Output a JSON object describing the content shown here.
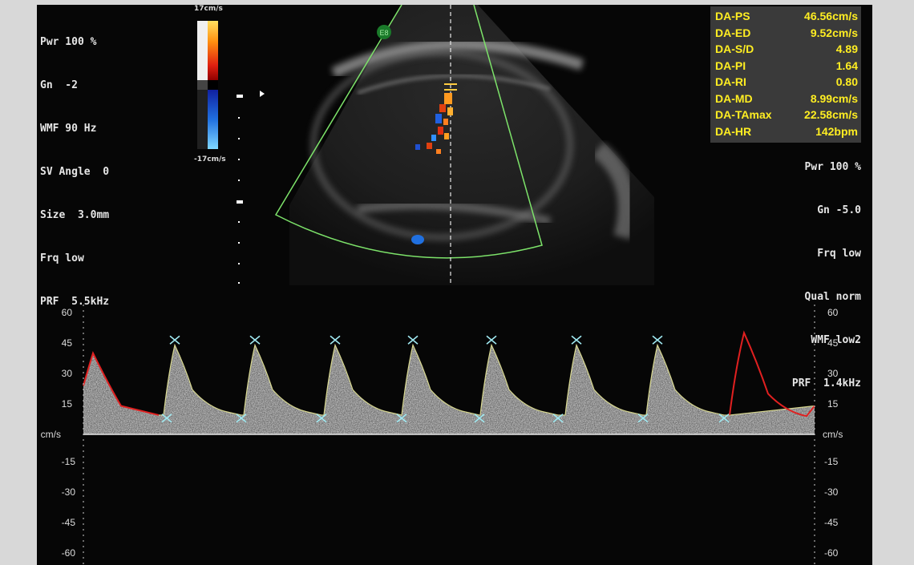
{
  "settings_left": [
    "Pwr 100 %",
    "Gn  -2",
    "WMF 90 Hz",
    "SV Angle  0",
    "Size  3.0mm",
    "Frq low",
    "PRF  5.5kHz"
  ],
  "color_scale": {
    "top_label": "17cm/s",
    "bottom_label": "-17cm/s"
  },
  "probe_badge": "E8",
  "measurements": [
    {
      "label": "DA-PS",
      "value": "46.56cm/s"
    },
    {
      "label": "DA-ED",
      "value": "9.52cm/s"
    },
    {
      "label": "DA-S/D",
      "value": "4.89"
    },
    {
      "label": "DA-PI",
      "value": "1.64"
    },
    {
      "label": "DA-RI",
      "value": "0.80"
    },
    {
      "label": "DA-MD",
      "value": "8.99cm/s"
    },
    {
      "label": "DA-TAmax",
      "value": "22.58cm/s"
    },
    {
      "label": "DA-HR",
      "value": "142bpm"
    }
  ],
  "settings_right": [
    "Pwr 100 %",
    "Gn -5.0",
    "Frq low",
    "Qual norm",
    "WMF low2",
    "PRF  1.4kHz"
  ],
  "doppler_axis": {
    "unit": "cm/s",
    "ticks_left": [
      "60",
      "45",
      "30",
      "15",
      "-15",
      "-30",
      "-45",
      "-60"
    ],
    "ticks_right": [
      "60",
      "45",
      "30",
      "15",
      "-15",
      "-30",
      "-45",
      "-60"
    ]
  },
  "colors": {
    "background": "#060606",
    "measure_text": "#ffee22",
    "sector_line": "#7de36a",
    "trace_red": "#e02020",
    "trace_yellow": "#d8d890",
    "marker_cyan": "#9fe8f0"
  }
}
